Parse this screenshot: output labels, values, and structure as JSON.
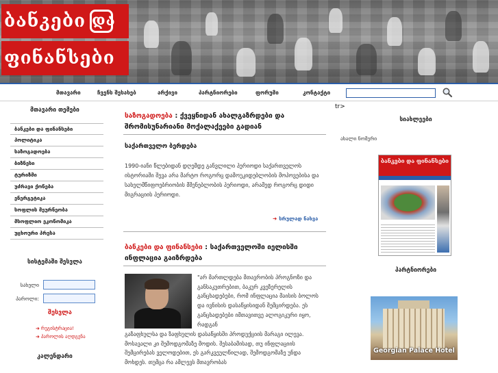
{
  "brand": {
    "logo_line1": "ბანკები",
    "logo_amp": "და",
    "logo_line2": "ფინანსები"
  },
  "nav": {
    "items": [
      "მთავარი",
      "ჩვენს შესახებ",
      "არქივი",
      "პარტნიორები",
      "ფორუმი",
      "კონტაქტი"
    ],
    "search_value": "",
    "search_icon": "magnifier-icon"
  },
  "left": {
    "topics_title": "მთავარი თემები",
    "topics": [
      "ბანკები და ფინანსები",
      "პოლიტიკა",
      "საზოგადოება",
      "ბიზნესი",
      "ტურიზმი",
      "უძრავი ქონება",
      "ენერგეტიკა",
      "სოფლის მეურნეობა",
      "მსოფლიო ეკონომიკა",
      "უცხოური პრესა"
    ],
    "login_title": "სისტემაში შესვლა",
    "username_label": "სახელი",
    "password_label": "პაროლი:",
    "login_button": "შესვლა",
    "register_link": "რეგისტრაცია!",
    "forgot_link": "პაროლის აღდგენა",
    "calendar_title": "კალენდარი"
  },
  "articles": [
    {
      "category": "საზოგადოება",
      "separator": " : ",
      "title": "ქვეყნიდან ახალგაზრდები და შრომისუნარიანი მოქალაქეები გადიან",
      "subhead": "საქართველო ბერდება",
      "body": "1990-იანი წლებიდან დღემდე განვლილი პერიოდი საქართველოს ისტორიაში შევა არა მარტო როგორც დამოუკიდებლობის მოპოვებისა და სახელმწიფოებრიობის მშენებლობის პერიოდი, არამედ როგორც დიდი მიგრაციის პერიოდი.",
      "more": "სრულად ნახვა"
    },
    {
      "category": "ბანკები და ფინანსები",
      "separator": " : ",
      "title": "საქართველოში იელისში ინფლაცია გაიზრდება",
      "quote": "\"არ მართლდება მთავრობის პროგნოზი და განსაკუთრებით, ბაკურ კვეზერელის განცხადებები, რომ ინფლაცია მაისის ბოლოს და ივნისის დასაწყისიდან შემცირდება. ეს განცხადებები იმთავითვე ალოგიკური იყო, რადგან",
      "continuation": "გაზაფხულსა და ზაფხულის დასაწყისში პროდუქციის მარაგი ილევა. მოსავალი კი შემოდგომაზე მოდის. შესაბამისად, თუ ინფლაციის შემცირებას ველოდებით, ეს გარკვეულწილად, შემოდგომაზე უნდა მოხდეს. თუმცა რა ამლევს მთავრობას"
    }
  ],
  "right": {
    "tr_text": "tr>",
    "news_title": "სიახლეები",
    "new_issue": "ახალი ნომერი",
    "cover_masthead": "ბანკები და ფინანსები",
    "partners_title": "პარტნიორები",
    "partner_name": "Georgian Palace Hotel"
  },
  "colors": {
    "brand_red": "#d01818",
    "link_blue": "#2a5da8"
  }
}
